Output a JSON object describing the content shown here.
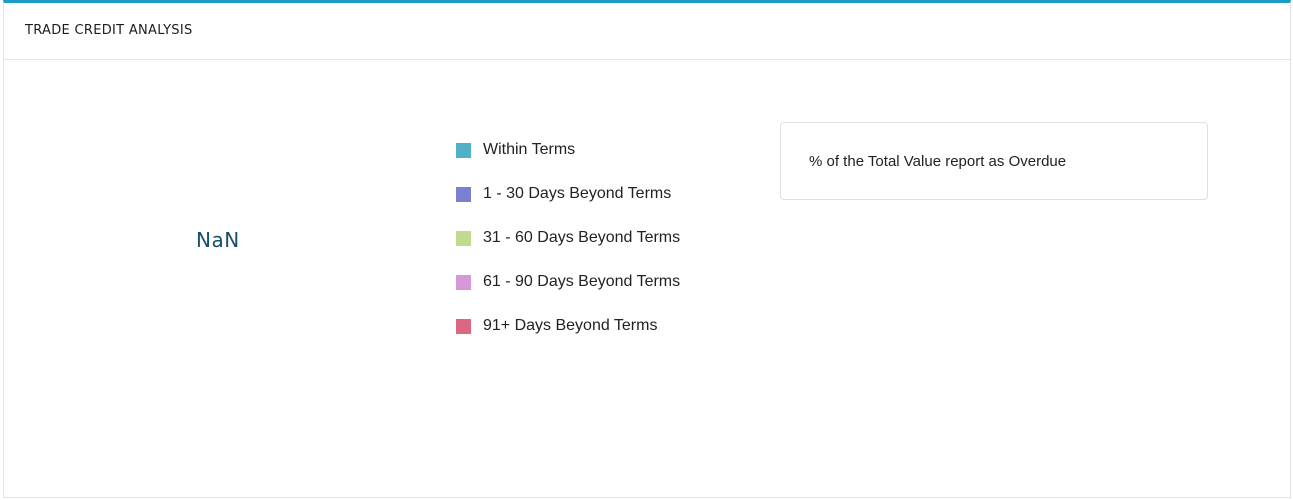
{
  "panel": {
    "title": "TRADE CREDIT ANALYSIS",
    "accent_color": "#1e9bc5"
  },
  "chart": {
    "center_value": "NaN",
    "legend": [
      {
        "label": "Within Terms",
        "color": "#4fb0c6"
      },
      {
        "label": "1 - 30 Days Beyond Terms",
        "color": "#7a80cf"
      },
      {
        "label": "31 - 60 Days Beyond Terms",
        "color": "#c3d98b"
      },
      {
        "label": "61 - 90 Days Beyond Terms",
        "color": "#d797d9"
      },
      {
        "label": "91+ Days Beyond Terms",
        "color": "#dd6681"
      }
    ]
  },
  "overdue_card": {
    "text": "% of the Total Value report as Overdue"
  }
}
